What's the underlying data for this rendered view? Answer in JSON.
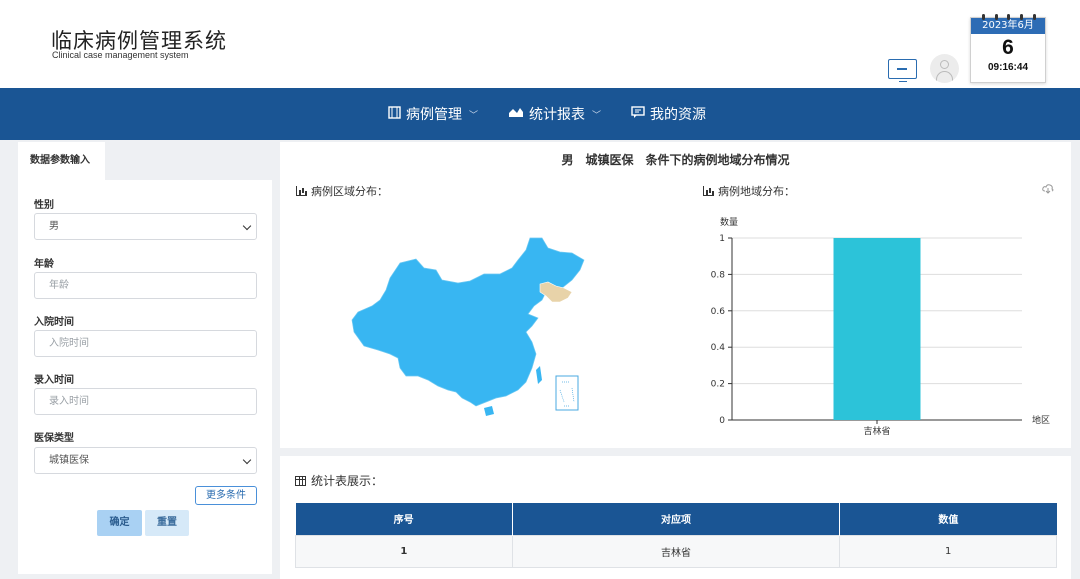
{
  "header": {
    "title": "临床病例管理系统",
    "subtitle": "Clinical case management system",
    "calendar": {
      "month": "2023年6月",
      "day": "6",
      "time": "09:16:44"
    }
  },
  "nav": {
    "items": [
      {
        "label": "病例管理",
        "icon": "film-icon",
        "has_dropdown": true
      },
      {
        "label": "统计报表",
        "icon": "area-chart-icon",
        "has_dropdown": true
      },
      {
        "label": "我的资源",
        "icon": "comment-icon",
        "has_dropdown": false
      }
    ]
  },
  "sidebar": {
    "tab": "数据参数输入",
    "gender": {
      "label": "性别",
      "value": "男"
    },
    "age": {
      "label": "年龄",
      "placeholder": "年龄"
    },
    "admit_time": {
      "label": "入院时间",
      "placeholder": "入院时间"
    },
    "entry_time": {
      "label": "录入时间",
      "placeholder": "录入时间"
    },
    "insurance": {
      "label": "医保类型",
      "value": "城镇医保"
    },
    "more_label": "更多条件",
    "confirm_label": "确定",
    "reset_label": "重置"
  },
  "main": {
    "title": "男　城镇医保　条件下的病例地域分布情况",
    "map_title": "病例区域分布：",
    "bar_title": "病例地域分布："
  },
  "colors": {
    "nav_bg": "#1a5594",
    "map_fill": "#38b6f2",
    "map_highlight": "#e8d3a9",
    "bar_fill": "#2cc3d9"
  },
  "chart_data": {
    "type": "bar",
    "categories": [
      "吉林省"
    ],
    "values": [
      1
    ],
    "title": "",
    "xlabel": "地区",
    "ylabel": "数量",
    "ylim": [
      0,
      1
    ],
    "yticks": [
      "0",
      "0.2",
      "0.4",
      "0.6",
      "0.8",
      "1"
    ]
  },
  "table": {
    "title": "统计表展示：",
    "headers": [
      "序号",
      "对应项",
      "数值"
    ],
    "rows": [
      {
        "idx": "1",
        "item": "吉林省",
        "value": "1"
      }
    ]
  }
}
